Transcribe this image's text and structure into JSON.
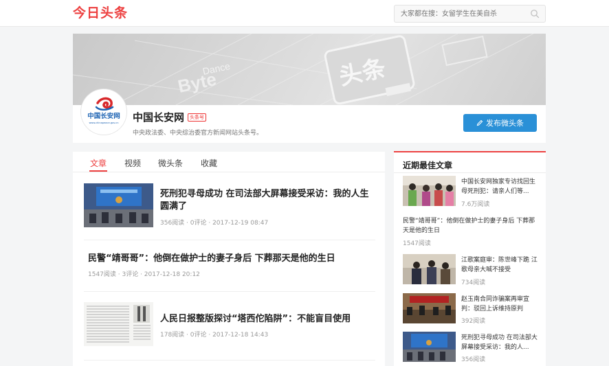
{
  "header": {
    "logo": "今日头条",
    "search_placeholder": "大家都在搜：女留学生在美自杀"
  },
  "profile": {
    "name": "中国长安网",
    "badge": "头条号",
    "description": "中央政法委、中央综治委官方新闻网站头条号。",
    "publish_label": "发布微头条",
    "avatar_text": "中国长安网",
    "avatar_url_text": "www.chinapeace.gov.cn"
  },
  "banner": {
    "words": [
      "Byte",
      "Dance",
      "头条"
    ]
  },
  "tabs": [
    {
      "label": "文章"
    },
    {
      "label": "视频"
    },
    {
      "label": "微头条"
    },
    {
      "label": "收藏"
    }
  ],
  "articles": [
    {
      "title": "死刑犯寻母成功 在司法部大屏幕接受采访：我的人生圆满了",
      "meta": "356阅读 · 0评论 · 2017-12-19 08:47"
    },
    {
      "title": "民警“靖哥哥”：他倒在做护士的妻子身后 下葬那天是他的生日",
      "meta": "1547阅读 · 3评论 · 2017-12-18 20:12"
    },
    {
      "title": "人民日报整版探讨“塔西佗陷阱”：不能盲目使用",
      "meta": "178阅读 · 0评论 · 2017-12-18 14:43"
    }
  ],
  "sidebar": {
    "title": "近期最佳文章",
    "items": [
      {
        "title": "中国长安网独家专访找回生母死刑犯：请亲人们等...",
        "meta": "7.6万阅读"
      },
      {
        "title": "民警“靖哥哥”：他倒在做护士的妻子身后 下葬那天是他的生日",
        "meta": "1547阅读"
      },
      {
        "title": "江歌案庭审：陈世峰下跪 江歌母亲大喊不接受",
        "meta": "734阅读"
      },
      {
        "title": "赵玉南合同诈骗案再审宣判：驳回上诉维持原判",
        "meta": "392阅读"
      },
      {
        "title": "死刑犯寻母成功 在司法部大屏幕接受采访：我的人...",
        "meta": "356阅读"
      }
    ]
  },
  "colors": {
    "brand_red": "#ed4040",
    "publish_blue": "#2a90d7"
  }
}
